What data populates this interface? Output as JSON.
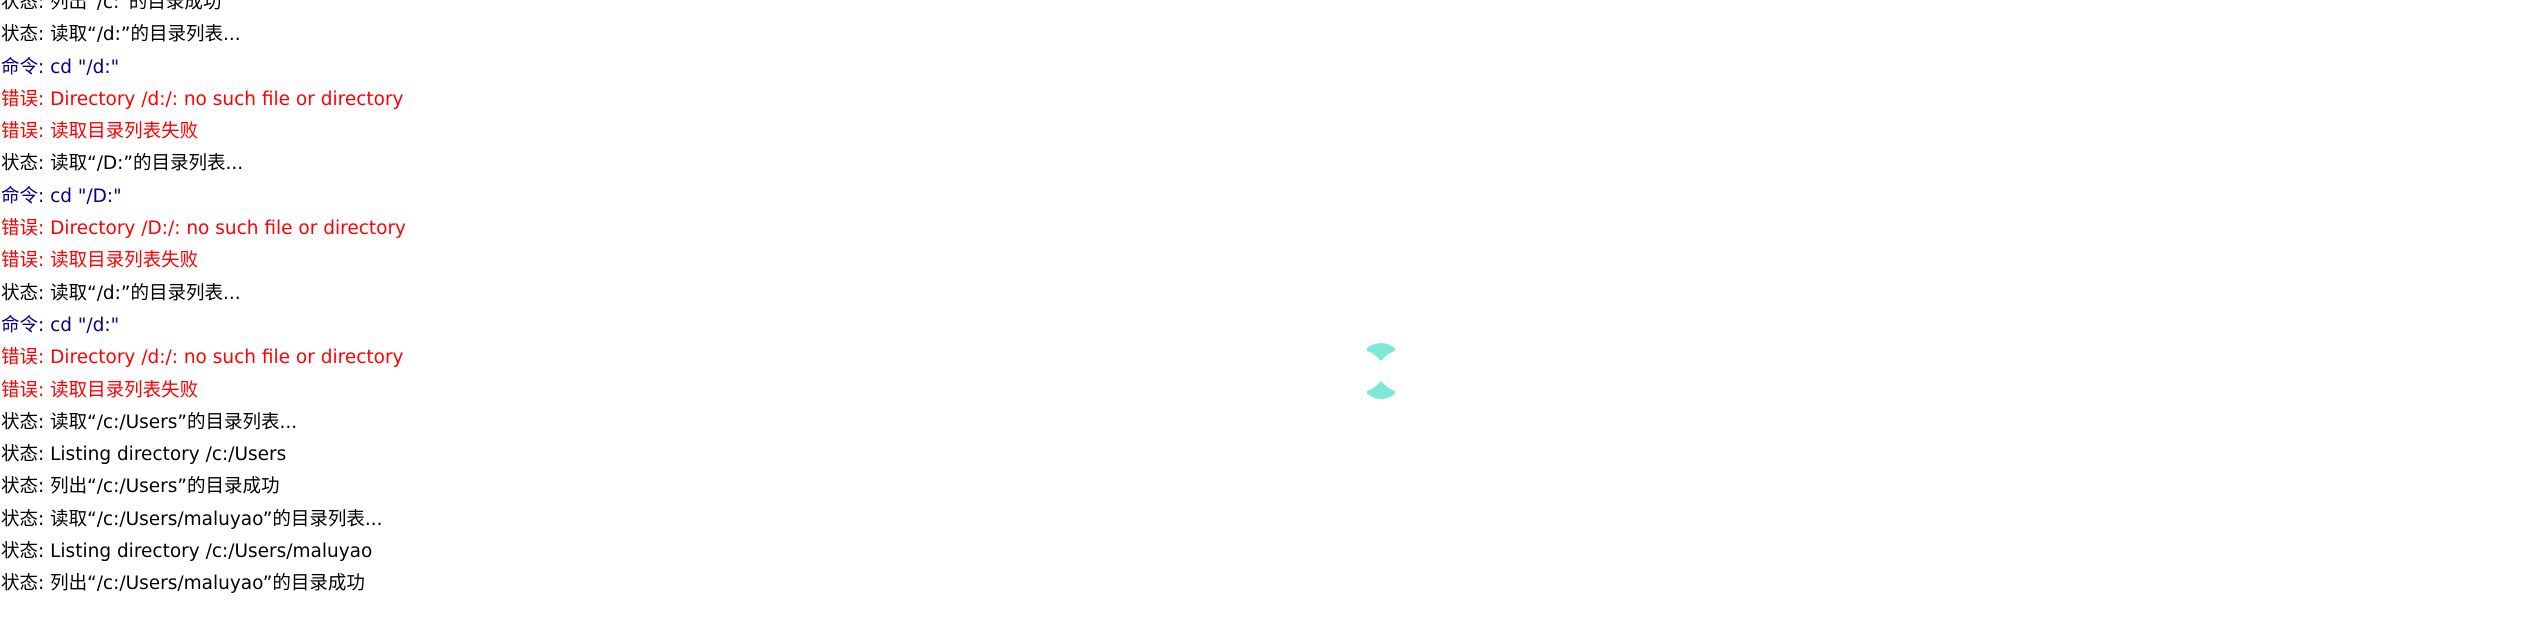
{
  "log": {
    "lines": [
      {
        "text": "状态: 列出“/c:”的目录成功",
        "level": "status"
      },
      {
        "text": "状态: 读取“/d:”的目录列表...",
        "level": "status"
      },
      {
        "text": "命令: cd \"/d:\"",
        "level": "command"
      },
      {
        "text": "错误: Directory /d:/: no such file or directory",
        "level": "error"
      },
      {
        "text": "错误: 读取目录列表失败",
        "level": "error"
      },
      {
        "text": "状态: 读取“/D:”的目录列表...",
        "level": "status"
      },
      {
        "text": "命令: cd \"/D:\"",
        "level": "command"
      },
      {
        "text": "错误: Directory /D:/: no such file or directory",
        "level": "error"
      },
      {
        "text": "错误: 读取目录列表失败",
        "level": "error"
      },
      {
        "text": "状态: 读取“/d:”的目录列表...",
        "level": "status"
      },
      {
        "text": "命令: cd \"/d:\"",
        "level": "command"
      },
      {
        "text": "错误: Directory /d:/: no such file or directory",
        "level": "error"
      },
      {
        "text": "错误: 读取目录列表失败",
        "level": "error"
      },
      {
        "text": "状态: 读取“/c:/Users”的目录列表...",
        "level": "status"
      },
      {
        "text": "状态: Listing directory /c:/Users",
        "level": "status"
      },
      {
        "text": "状态: 列出“/c:/Users”的目录成功",
        "level": "status"
      },
      {
        "text": "状态: 读取“/c:/Users/maluyao”的目录列表...",
        "level": "status"
      },
      {
        "text": "状态: Listing directory /c:/Users/maluyao",
        "level": "status"
      },
      {
        "text": "状态: 列出“/c:/Users/maluyao”的目录成功",
        "level": "status"
      }
    ]
  },
  "resize_handle": {
    "icon": "double-chevron-resize-icon",
    "color": "#7de8d8"
  },
  "colors": {
    "status": "#000000",
    "command": "#00008b",
    "error": "#ff0000"
  }
}
